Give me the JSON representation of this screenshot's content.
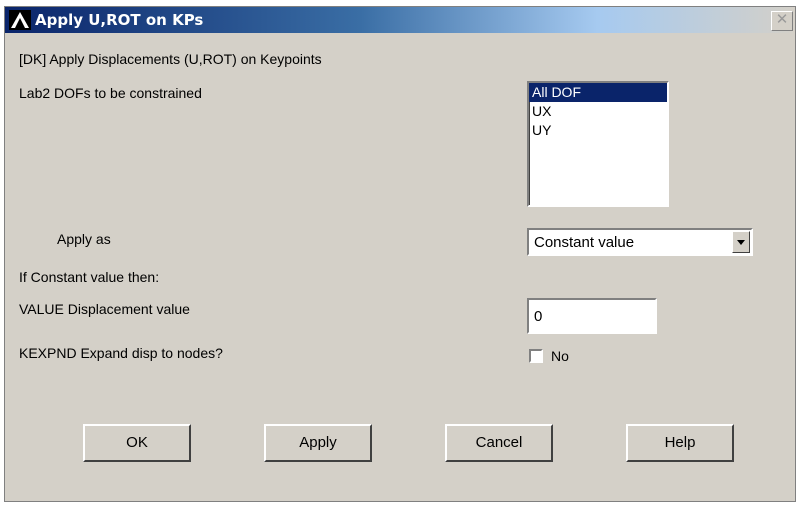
{
  "window": {
    "title": "Apply U,ROT on KPs",
    "close_label": "✕"
  },
  "dialog": {
    "command_label": "[DK]  Apply Displacements (U,ROT) on Keypoints",
    "lab2_label": "Lab2   DOFs to be constrained",
    "dof_list": {
      "items": [
        {
          "label": "All DOF",
          "selected": true
        },
        {
          "label": "UX",
          "selected": false
        },
        {
          "label": "UY",
          "selected": false
        }
      ]
    },
    "apply_as_label": "Apply as",
    "apply_as_value": "Constant value",
    "constant_section_label": "If Constant value then:",
    "value_label": "VALUE  Displacement value",
    "value_input": "0",
    "kexpnd_label": "KEXPND  Expand disp to nodes?",
    "kexpnd_checked": false,
    "kexpnd_option": "No"
  },
  "buttons": {
    "ok": "OK",
    "apply": "Apply",
    "cancel": "Cancel",
    "help": "Help"
  }
}
